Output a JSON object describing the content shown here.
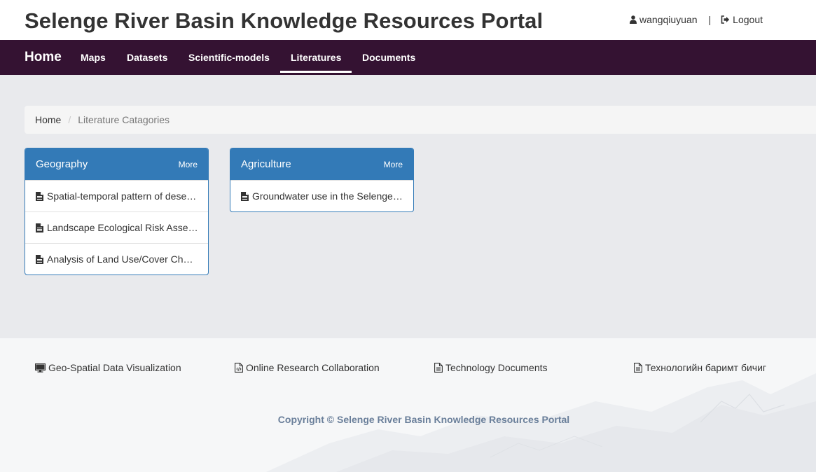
{
  "header": {
    "title": "Selenge River Basin Knowledge Resources Portal",
    "username": "wangqiuyuan",
    "separator": "|",
    "logout_label": "Logout",
    "user_icon": "user-icon",
    "logout_icon": "logout-icon"
  },
  "nav": {
    "brand": "Home",
    "items": [
      "Maps",
      "Datasets",
      "Scientific-models",
      "Literatures",
      "Documents"
    ],
    "active": "Literatures"
  },
  "breadcrumb": {
    "home": "Home",
    "separator": "/",
    "current": "Literature Catagories"
  },
  "panels": [
    {
      "title": "Geography",
      "more": "More",
      "items": [
        "Spatial-temporal pattern of desertification in the Selenge River Basin",
        "Landscape Ecological Risk Assessment of the Selenge River Basin",
        "Analysis of Land Use/Cover Change in the Selenge River Basin"
      ]
    },
    {
      "title": "Agriculture",
      "more": "More",
      "items": [
        "Groundwater use in the Selenge River Basin"
      ]
    }
  ],
  "footer": {
    "links": [
      {
        "label": "Geo-Spatial Data Visualization",
        "icon": "monitor-icon"
      },
      {
        "label": "Online Research Collaboration",
        "icon": "code-file-icon"
      },
      {
        "label": "Technology Documents",
        "icon": "document-icon"
      },
      {
        "label": "Технологийн баримт бичиг",
        "icon": "document-icon"
      }
    ],
    "copyright": "Copyright © Selenge River Basin Knowledge Resources Portal"
  },
  "colors": {
    "nav_bg": "#341232",
    "panel_primary": "#337ab7",
    "main_bg": "#e9eaed",
    "copyright_text": "#6a7f9a"
  }
}
